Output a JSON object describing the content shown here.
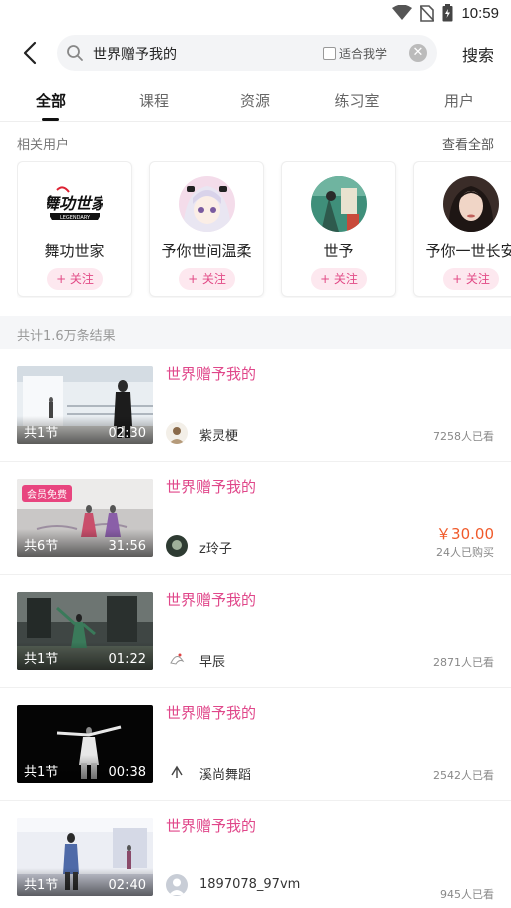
{
  "status": {
    "time": "10:59"
  },
  "search": {
    "query": "世界赠予我的",
    "fit_label": "适合我学",
    "clear": "✕",
    "submit": "搜索"
  },
  "tabs": [
    {
      "label": "全部"
    },
    {
      "label": "课程"
    },
    {
      "label": "资源"
    },
    {
      "label": "练习室"
    },
    {
      "label": "用户"
    }
  ],
  "related_users": {
    "title": "相关用户",
    "see_all": "查看全部",
    "items": [
      {
        "name": "舞功世家",
        "follow": "+ 关注",
        "logo_text": "舞功世家",
        "logo_sub": "LEGENDARY"
      },
      {
        "name": "予你世间温柔",
        "follow": "+ 关注"
      },
      {
        "name": "世予",
        "follow": "+ 关注"
      },
      {
        "name": "予你一世长安",
        "follow": "+ 关注"
      }
    ]
  },
  "results": {
    "count_text": "共计1.6万条结果",
    "items": [
      {
        "title": "世界赠予我的",
        "lessons": "共1节",
        "duration": "02:30",
        "author": "紫灵梗",
        "viewers": "7258人已看"
      },
      {
        "title": "世界赠予我的",
        "lessons": "共6节",
        "duration": "31:56",
        "author": "z玲子",
        "badge": "会员免费",
        "price": "￥30.00",
        "purchased": "24人已购买"
      },
      {
        "title": "世界赠予我的",
        "lessons": "共1节",
        "duration": "01:22",
        "author": "早辰",
        "viewers": "2871人已看"
      },
      {
        "title": "世界赠予我的",
        "lessons": "共1节",
        "duration": "00:38",
        "author": "溪尚舞蹈",
        "viewers": "2542人已看"
      },
      {
        "title": "世界赠予我的",
        "lessons": "共1节",
        "duration": "02:40",
        "author": "1897078_97vm",
        "viewers": "945人已看"
      }
    ]
  },
  "colors": {
    "accent": "#e0478a",
    "price": "#f05a2a",
    "follow_bg": "#fde8ef"
  }
}
